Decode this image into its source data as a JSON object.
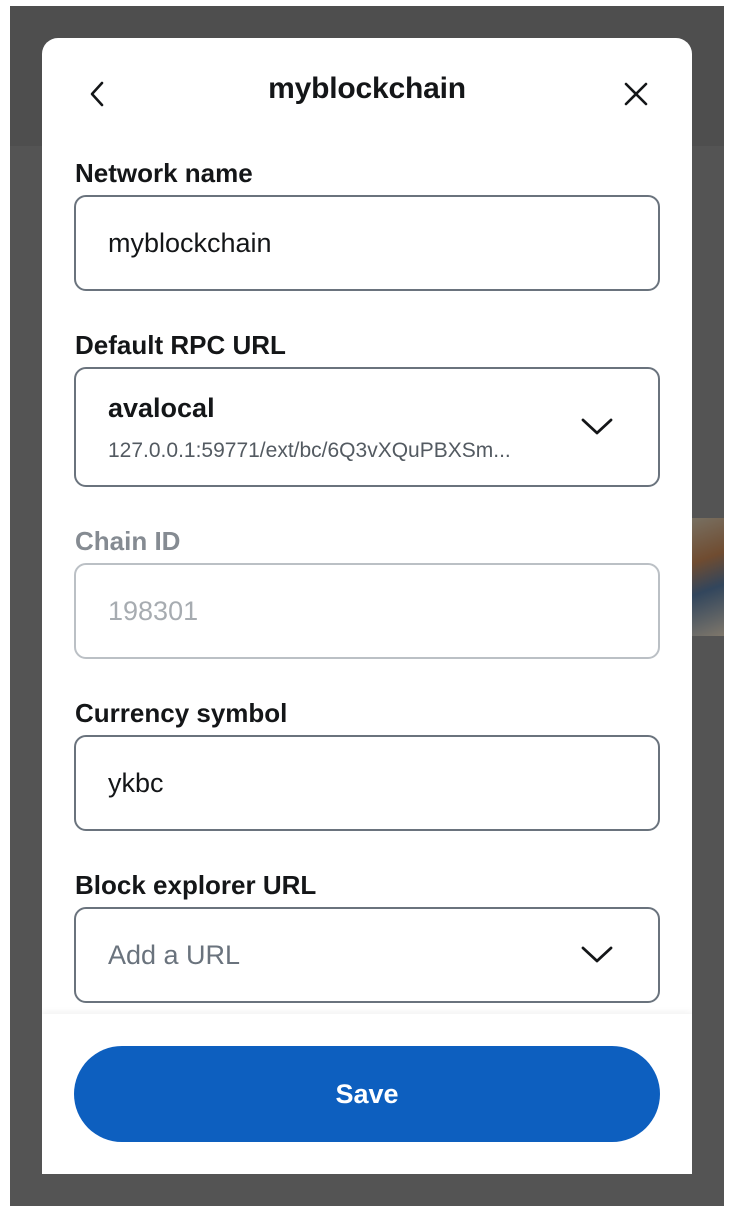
{
  "header": {
    "title": "myblockchain",
    "back_icon": "chevron-left-icon",
    "close_icon": "close-icon"
  },
  "fields": {
    "network_name": {
      "label": "Network name",
      "value": "myblockchain"
    },
    "rpc_url": {
      "label": "Default RPC URL",
      "name": "avalocal",
      "url": "127.0.0.1:59771/ext/bc/6Q3vXQuPBXSm..."
    },
    "chain_id": {
      "label": "Chain ID",
      "value": "198301"
    },
    "currency_symbol": {
      "label": "Currency symbol",
      "value": "ykbc"
    },
    "block_explorer": {
      "label": "Block explorer URL",
      "placeholder": "Add a URL"
    }
  },
  "footer": {
    "save_label": "Save"
  },
  "colors": {
    "primary": "#0d5fbf",
    "text": "#141618",
    "border": "#6a737d",
    "disabled": "#bbc0c5"
  }
}
